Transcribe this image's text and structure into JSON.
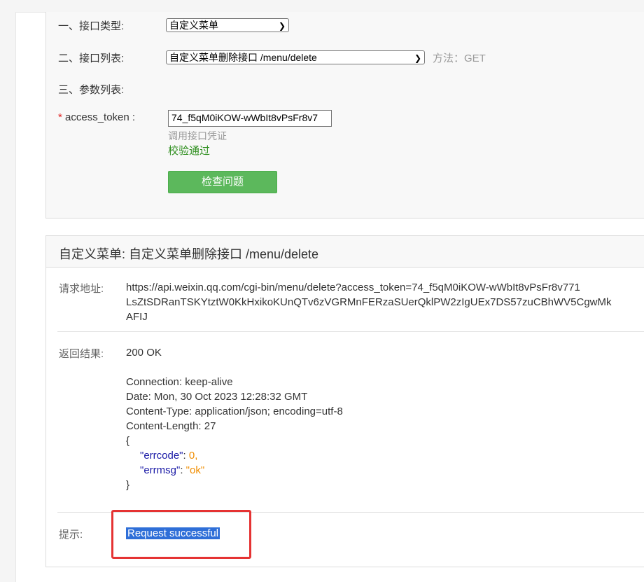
{
  "form": {
    "interface_type": {
      "label": "一、接口类型:",
      "value": "自定义菜单"
    },
    "interface_list": {
      "label": "二、接口列表:",
      "value": "自定义菜单删除接口 /menu/delete",
      "method": "方法：GET"
    },
    "param_list_label": "三、参数列表:",
    "access_token": {
      "required_mark": "*",
      "label": "access_token :",
      "value": "74_f5qM0iKOW-wWbIt8vPsFr8v7",
      "hint": "调用接口凭证",
      "validation": "校验通过"
    },
    "check_button": "检查问题"
  },
  "result": {
    "title": "自定义菜单: 自定义菜单删除接口 /menu/delete",
    "request_label": "请求地址:",
    "request_url_lines": [
      "https://api.weixin.qq.com/cgi-bin/menu/delete?access_token=74_f5qM0iKOW-wWbIt8vPsFr8v771",
      "LsZtSDRanTSKYtztW0KkHxikoKUnQTv6zVGRMnFERzaSUerQklPW2zIgUEx7DS57zuCBhWV5CgwMk",
      "AFIJ"
    ],
    "response_label": "返回结果:",
    "status": "200 OK",
    "headers": [
      "Connection: keep-alive",
      "Date: Mon, 30 Oct 2023 12:28:32 GMT",
      "Content-Type: application/json; encoding=utf-8",
      "Content-Length: 27"
    ],
    "json_open": "{",
    "json_errcode_key": "\"errcode\"",
    "json_errcode_val": "0,",
    "json_errmsg_key": "\"errmsg\"",
    "json_errmsg_val": "\"ok\"",
    "json_close": "}",
    "colon": ": ",
    "tip_label": "提示:",
    "tip_value": "Request successful"
  },
  "colors": {
    "button_green": "#5cb85c",
    "validation_green": "#2f8f1f",
    "highlight_red": "#e53333",
    "selection_blue": "#2f6fd8"
  }
}
